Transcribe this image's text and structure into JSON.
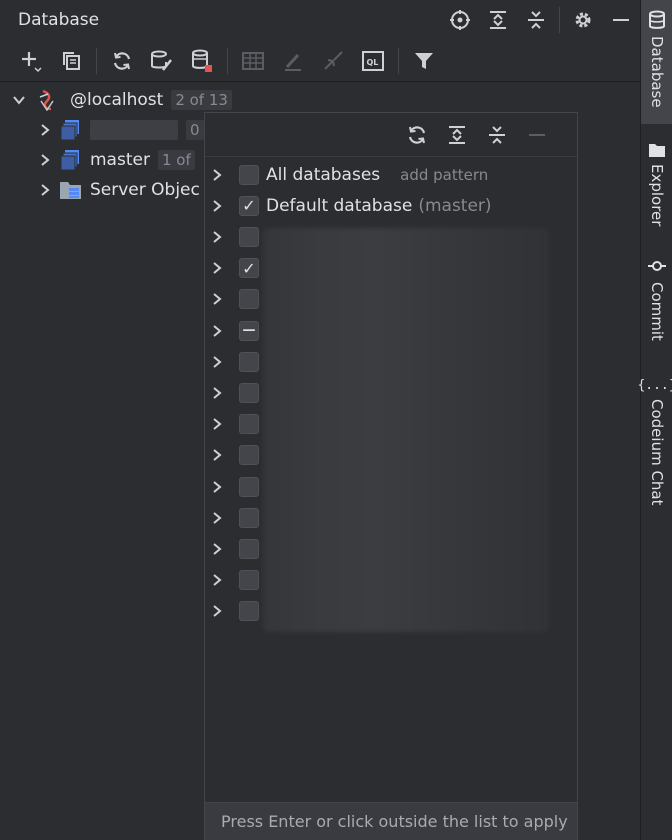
{
  "panel": {
    "title": "Database"
  },
  "tree": {
    "root": {
      "label": "@localhost",
      "badge": "2 of 13"
    },
    "items": [
      {
        "label": "",
        "badge": "0"
      },
      {
        "label": "master",
        "badge": "1 of"
      },
      {
        "label": "Server Objec"
      }
    ]
  },
  "popup": {
    "rows": [
      {
        "label": "All databases",
        "hint": "add pattern",
        "state": "unchecked"
      },
      {
        "label": "Default database",
        "sub": "(master)",
        "state": "checked"
      },
      {
        "label": "",
        "state": "unchecked"
      },
      {
        "label": "",
        "state": "checked"
      },
      {
        "label": "",
        "state": "unchecked"
      },
      {
        "label": "",
        "state": "partial"
      },
      {
        "label": "",
        "state": "unchecked"
      },
      {
        "label": "",
        "state": "unchecked"
      },
      {
        "label": "",
        "state": "unchecked"
      },
      {
        "label": "",
        "state": "unchecked"
      },
      {
        "label": "",
        "state": "unchecked"
      },
      {
        "label": "",
        "state": "unchecked"
      },
      {
        "label": "",
        "state": "unchecked"
      },
      {
        "label": "",
        "state": "unchecked"
      },
      {
        "label": "",
        "state": "unchecked"
      }
    ],
    "footer": "Press Enter or click outside the list to apply",
    "checkmark": "✓",
    "partial_mark": "—"
  },
  "sidebar": {
    "items": [
      {
        "label": "Database",
        "icon": "database-icon"
      },
      {
        "label": "Explorer",
        "icon": "folder-icon"
      },
      {
        "label": "Commit",
        "icon": "commit-icon"
      },
      {
        "label": "Codeium Chat",
        "icon": "braces-icon",
        "glyph": "{...}"
      }
    ]
  },
  "colors": {
    "accent": "#548af7",
    "bg": "#2b2d30",
    "red": "#e55353"
  }
}
